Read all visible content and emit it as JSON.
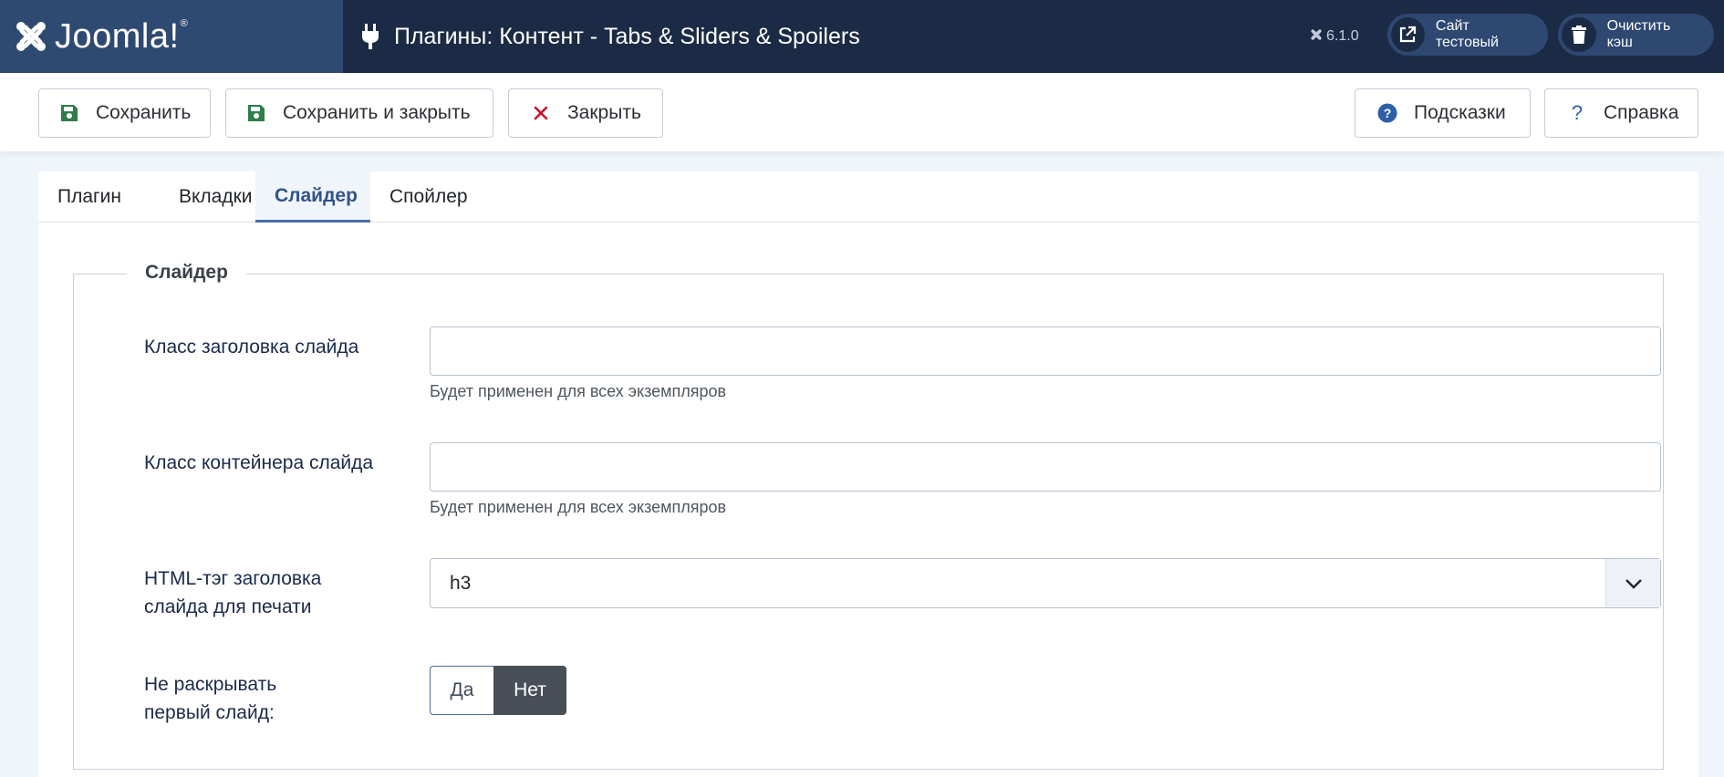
{
  "header": {
    "brand": "Joomla!",
    "brand_reg": "®",
    "title": "Плагины: Контент - Tabs & Sliders & Spoilers",
    "version": "6.1.0",
    "site_button": "Сайт тестовый",
    "cache_button": "Очистить кэш",
    "icons": [
      "joomla-logo-icon",
      "plug-icon",
      "joomla-small-icon",
      "external-link-icon",
      "trash-icon"
    ]
  },
  "toolbar": {
    "save": "Сохранить",
    "save_close": "Сохранить и закрыть",
    "close": "Закрыть",
    "tips": "Подсказки",
    "help": "Справка"
  },
  "tabs": [
    {
      "label": "Плагин"
    },
    {
      "label": "Вкладки"
    },
    {
      "label": "Слайдер",
      "active": true
    },
    {
      "label": "Спойлер"
    }
  ],
  "fieldset": {
    "legend": "Слайдер",
    "fields": {
      "title_class": {
        "label": "Класс заголовка слайда",
        "value": "",
        "hint": "Будет применен для всех экземпляров"
      },
      "container_class": {
        "label": "Класс контейнера слайда",
        "value": "",
        "hint": "Будет применен для всех экземпляров"
      },
      "print_tag": {
        "label_line1": "HTML-тэг заголовка",
        "label_line2": "слайда для печати",
        "value": "h3"
      },
      "no_expand_first": {
        "label_line1": "Не раскрывать",
        "label_line2": "первый слайд:",
        "yes": "Да",
        "no": "Нет",
        "selected": "Нет"
      }
    }
  },
  "colors": {
    "header_bg": "#1c2b45",
    "brand_bg": "#2f4a72",
    "save_icon": "#2e7d4a",
    "close_icon": "#c8102e",
    "tips_icon": "#2d5fa8",
    "active_tab": "#2f5388"
  }
}
